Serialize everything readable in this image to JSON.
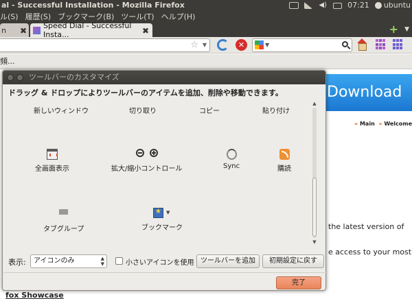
{
  "window": {
    "title": "al - Successful Installation - Mozilla Firefox"
  },
  "panel": {
    "time": "07:21",
    "user": "ubuntu"
  },
  "menubar": {
    "items": [
      "ル(S)",
      "履歴(S)",
      "ブックマーク(B)",
      "ツール(T)",
      "ヘルプ(H)"
    ]
  },
  "tabs": [
    {
      "label": "n",
      "active": false
    },
    {
      "label": "Speed Dial - Successful Insta...",
      "active": true
    }
  ],
  "bookmarks_bar": {
    "text": "頻..."
  },
  "page": {
    "ad_text": "Download",
    "nav_main": "Main",
    "nav_welcome": "Welcome",
    "text_1": "the latest version of",
    "text_2": "e access to your most",
    "text_3": "fox Showcase"
  },
  "dialog": {
    "title": "ツールバーのカスタマイズ",
    "instructions": "ドラッグ & ドロップによりツールバーのアイテムを追加、削除や移動できます。",
    "items": [
      {
        "label": "新しいウィンドウ",
        "icon": "new-window-icon"
      },
      {
        "label": "切り取り",
        "icon": "cut-icon"
      },
      {
        "label": "コピー",
        "icon": "copy-icon"
      },
      {
        "label": "貼り付け",
        "icon": "paste-icon"
      },
      {
        "label": "全画面表示",
        "icon": "fullscreen-icon"
      },
      {
        "label": "拡大/縮小コントロール",
        "icon": "zoom-icon"
      },
      {
        "label": "Sync",
        "icon": "sync-icon"
      },
      {
        "label": "購読",
        "icon": "rss-icon"
      },
      {
        "label": "タブグループ",
        "icon": "tab-groups-icon"
      },
      {
        "label": "ブックマーク",
        "icon": "bookmarks-icon"
      }
    ],
    "show_label": "表示:",
    "show_value": "アイコンのみ",
    "small_icons_label": "小さいアイコンを使用",
    "small_icons_checked": false,
    "add_toolbar_label": "ツールバーを追加",
    "reset_label": "初期設定に戻す",
    "done_label": "完了"
  }
}
